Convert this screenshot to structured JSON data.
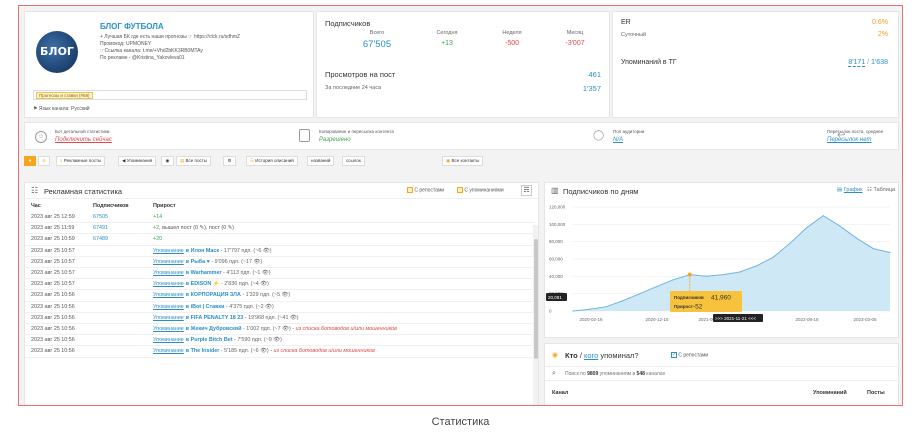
{
  "channel": {
    "title": "БЛОГ ФУТБОЛА",
    "desc_lines": [
      "+ Лучшая БК где есть наши прогнозы ☞ https://clck.ru/sdhmZ",
      "Промокод: UPMONEY",
      "☞Ссылка канала: t.me/+Vhd2bKK3RB0MTAy",
      "По рекламе - @Kristina_Yakovleva01"
    ],
    "tag": "Прогнозы и ставки (#59)",
    "lang": "Язык канала: Русский",
    "logo_text": "БЛОГ"
  },
  "subscribers": {
    "title": "Подписчиков",
    "cols": [
      "Всего",
      "Сегодня",
      "Неделя",
      "Месяц"
    ],
    "vals": [
      "67'505",
      "+13",
      "-500",
      "-3'007"
    ],
    "views_title": "Просмотров на пост",
    "views_val": "461",
    "last24_label": "За последние 24 часа",
    "last24_val": "1'357"
  },
  "er": {
    "label": "ER",
    "val": "0.6%",
    "daily_label": "Суточный",
    "daily_val": "2%",
    "mentions_label": "Упоминаний в ТГ",
    "mentions_val": "8'171",
    "mentions_sep": " / ",
    "mentions_val2": "1'638"
  },
  "info_strip": [
    {
      "title": "Бот детальной статистики",
      "value": "Подключить сейчас",
      "color": "#e04848"
    },
    {
      "title": "Копирование и пересылка контента",
      "value": "Разрешено",
      "color": "#3ba553"
    },
    {
      "title": "Пол аудитории",
      "value": "N/A",
      "color": "#2a8fc9"
    },
    {
      "title": "Пересылок поста, среднее",
      "value": "Пересылок нет",
      "color": "#2a8fc9"
    }
  ],
  "toolbar": {
    "search": "Рекламные посты",
    "mentions": "Упоминания",
    "all_posts": "Все посты",
    "history": "История описаний",
    "name": "названий",
    "links": "ссылок",
    "contacts": "Все контакты"
  },
  "ad_stats": {
    "title": "Рекламная статистика",
    "opt1": "С репостами",
    "opt2": "С упоминаниями",
    "headers": [
      "Час",
      "Подписчиков",
      "Прирост"
    ],
    "rows": [
      {
        "time": "2023 авг 25 12:59",
        "subs": "67505",
        "growth": "+14",
        "kind": "g"
      },
      {
        "time": "2023 авг 25 11:59",
        "subs": "67491",
        "growth": "+2",
        "extra": ", вышел пост (0 ✎), пост (0 ✎)",
        "kind": "g"
      },
      {
        "time": "2023 авг 25 10:59",
        "subs": "67489",
        "growth": "+20",
        "kind": "g"
      },
      {
        "time": "2023 авг 25 10:57",
        "mention": "Упоминание",
        "target": "в Илон Маск",
        "detail": " - 17'797 пдп. (~6 👁)",
        "kind": "m"
      },
      {
        "time": "2023 авг 25 10:57",
        "mention": "Упоминание",
        "target": "в Рыба ♥",
        "detail": " - 9'096 пдп. (~17 👁)",
        "kind": "m"
      },
      {
        "time": "2023 авг 25 10:57",
        "mention": "Упоминание",
        "target": "в Warhammer",
        "detail": " - 4'113 пдп. (~1 👁)",
        "kind": "m"
      },
      {
        "time": "2023 авг 25 10:57",
        "mention": "Упоминание",
        "target": "в EDISON ⚡",
        "detail": " - 2'836 пдп. (~4 👁)",
        "kind": "m"
      },
      {
        "time": "2023 авг 25 10:56",
        "mention": "Упоминание",
        "target": "в КОРПОРАЦИЯ ЗЛА",
        "detail": " - 1'329 пдп. (~5 👁)",
        "kind": "m"
      },
      {
        "time": "2023 авг 25 10:56",
        "mention": "Упоминание",
        "target": "в iBot | Ставки",
        "detail": " - 4'375 пдп. (~2 👁)",
        "kind": "m"
      },
      {
        "time": "2023 авг 25 10:56",
        "mention": "Упоминание",
        "target": "в FIFA PENALTY 18 23",
        "detail": " - 19'968 пдп. (~41 👁)",
        "kind": "m"
      },
      {
        "time": "2023 авг 25 10:56",
        "mention": "Упоминание",
        "target": "в Жекич Дубровский",
        "detail": " - 1'002 пдп. (~7 👁)",
        "warn": " - из списка ботоводов и/или мошенников",
        "kind": "m"
      },
      {
        "time": "2023 авг 25 10:56",
        "mention": "Упоминание",
        "target": "в Purple Bitch Bet",
        "detail": " - 7'590 пдп. (~9 👁)",
        "kind": "m"
      },
      {
        "time": "2023 авг 25 10:56",
        "mention": "Упоминание",
        "target": "в The Insider",
        "detail": " - 5'185 пдп. (~6 👁)",
        "warn": " - из списка ботоводов и/или мошенников",
        "kind": "m"
      }
    ]
  },
  "subs_chart": {
    "title": "Подписчиков по дням",
    "tab_graph": "График",
    "tab_table": "Таблица",
    "tooltip_subs_label": "Подписчиков",
    "tooltip_subs_val": "41,960",
    "tooltip_growth_label": "Прирост",
    "tooltip_growth_val": "-52",
    "date_badge": ">>> 2021-11-21 <<<",
    "left_badge": "20,081"
  },
  "chart_data": {
    "type": "area",
    "y_ticks": [
      "120,000",
      "100,000",
      "80,000",
      "60,000",
      "40,000",
      "20,000",
      "0"
    ],
    "x_ticks": [
      "2020-02-16",
      "2020-12-15",
      "2021-06-13",
      "2022-08-18",
      "2023-03-05"
    ],
    "ylim": [
      0,
      120000
    ],
    "series": [
      {
        "values": [
          0,
          2000,
          5000,
          12000,
          20000,
          28000,
          36000,
          41960,
          40000,
          42000,
          45000,
          52000,
          62000,
          78000,
          96000,
          110000,
          98000,
          84000,
          72000,
          67505
        ]
      }
    ]
  },
  "who_mentioned": {
    "title_who": "Кто",
    "title_sep": " / ",
    "title_whom": "кого",
    "title_rest": " упоминал?",
    "repost_opt": "С репостами",
    "search_prefix": "Поиск по ",
    "search_count": "9809",
    "search_mid": " упоминаниям в ",
    "search_channels": "548",
    "search_suffix": " каналах",
    "col_channel": "Канал",
    "col_mentions": "Упоминаний",
    "col_posts": "Посты"
  },
  "caption": "Статистика"
}
